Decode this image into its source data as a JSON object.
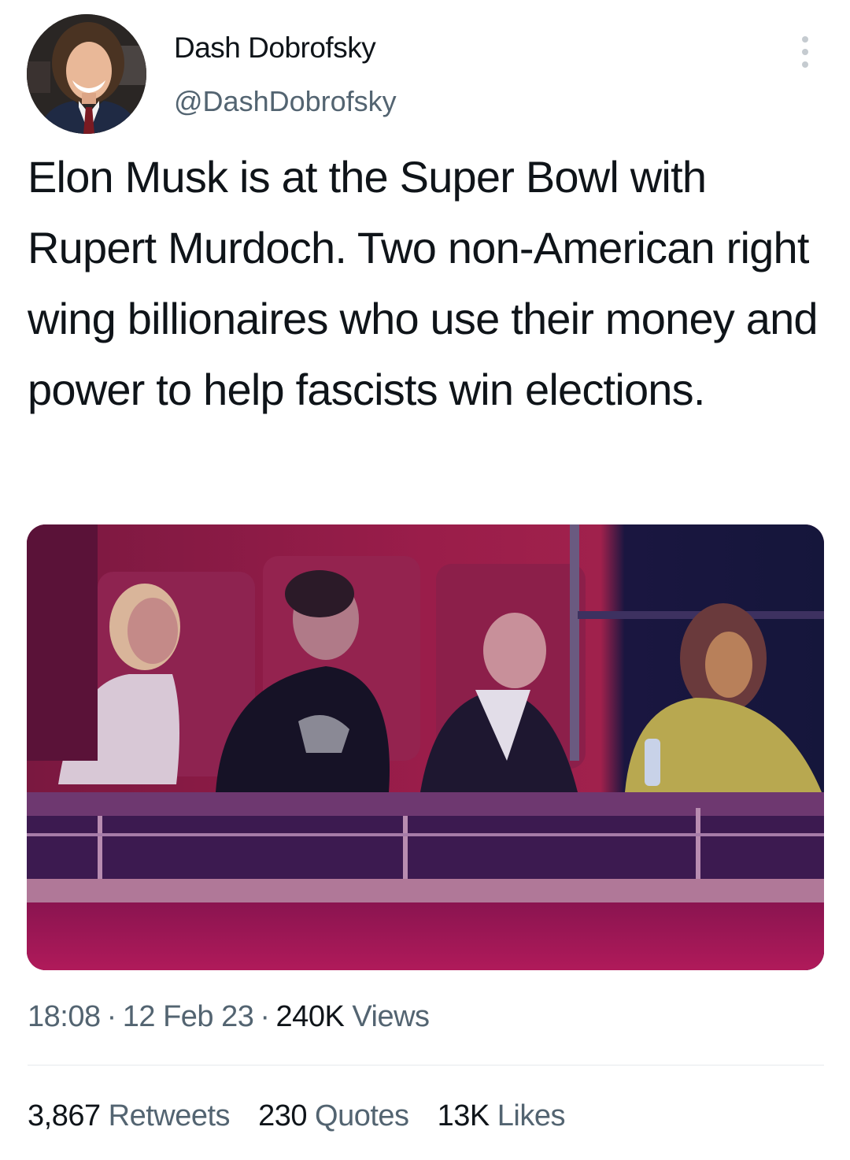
{
  "author": {
    "display_name": "Dash Dobrofsky",
    "handle": "@DashDobrofsky"
  },
  "tweet": {
    "text": "Elon Musk is at the Super Bowl with Rupert Murdoch. Two non-American right wing billionaires who use their money and power to help fascists win elections.",
    "time": "18:08",
    "date": "12 Feb 23",
    "views_count": "240K",
    "views_label": "Views"
  },
  "stats": {
    "retweets_count": "3,867",
    "retweets_label": "Retweets",
    "quotes_count": "230",
    "quotes_label": "Quotes",
    "likes_count": "13K",
    "likes_label": "Likes"
  },
  "icons": {
    "more": "more-options-icon"
  },
  "colors": {
    "text_primary": "#0f1419",
    "text_secondary": "#536471",
    "divider": "#e6e9ec"
  }
}
